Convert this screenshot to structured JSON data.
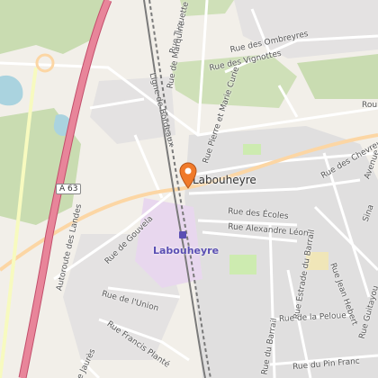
{
  "map": {
    "town_name": "Labouheyre",
    "station_name": "Labouheyre",
    "highway_shield": "A 63",
    "colors": {
      "background": "#f2efe9",
      "forest": "#c9dcb1",
      "water": "#aad3df",
      "motorway": "#e8859a",
      "motorway_casing": "#c24e6b",
      "primary": "#fcd6a4",
      "railway": "#7a7a7a",
      "residential": "#e0dfdf",
      "station_area": "#e8d7ee",
      "marker": "#f07a2a"
    },
    "street_labels": [
      "Rue Tuquette",
      "Rue de Marquine",
      "Rue des Ombreyres",
      "Rue des Vignottes",
      "Ligne de Bordeaux",
      "Rue Pierre et Marie Curie",
      "Rou",
      "Rue des Chevreuils",
      "Avenue",
      "Autoroute des Landes",
      "Rue de Gouvela",
      "Rue des Écoles",
      "Rue Alexandre Léon",
      "Rue du Barrail",
      "Rue Estrade du Barrail",
      "Rue Jean Hebert",
      "Rue Guitayou",
      "Rue de l'Union",
      "Rue Francis Planté",
      "Rue de la Peloue",
      "Rue du Pin Franc",
      "Rue Jaurès",
      "Sina"
    ]
  }
}
